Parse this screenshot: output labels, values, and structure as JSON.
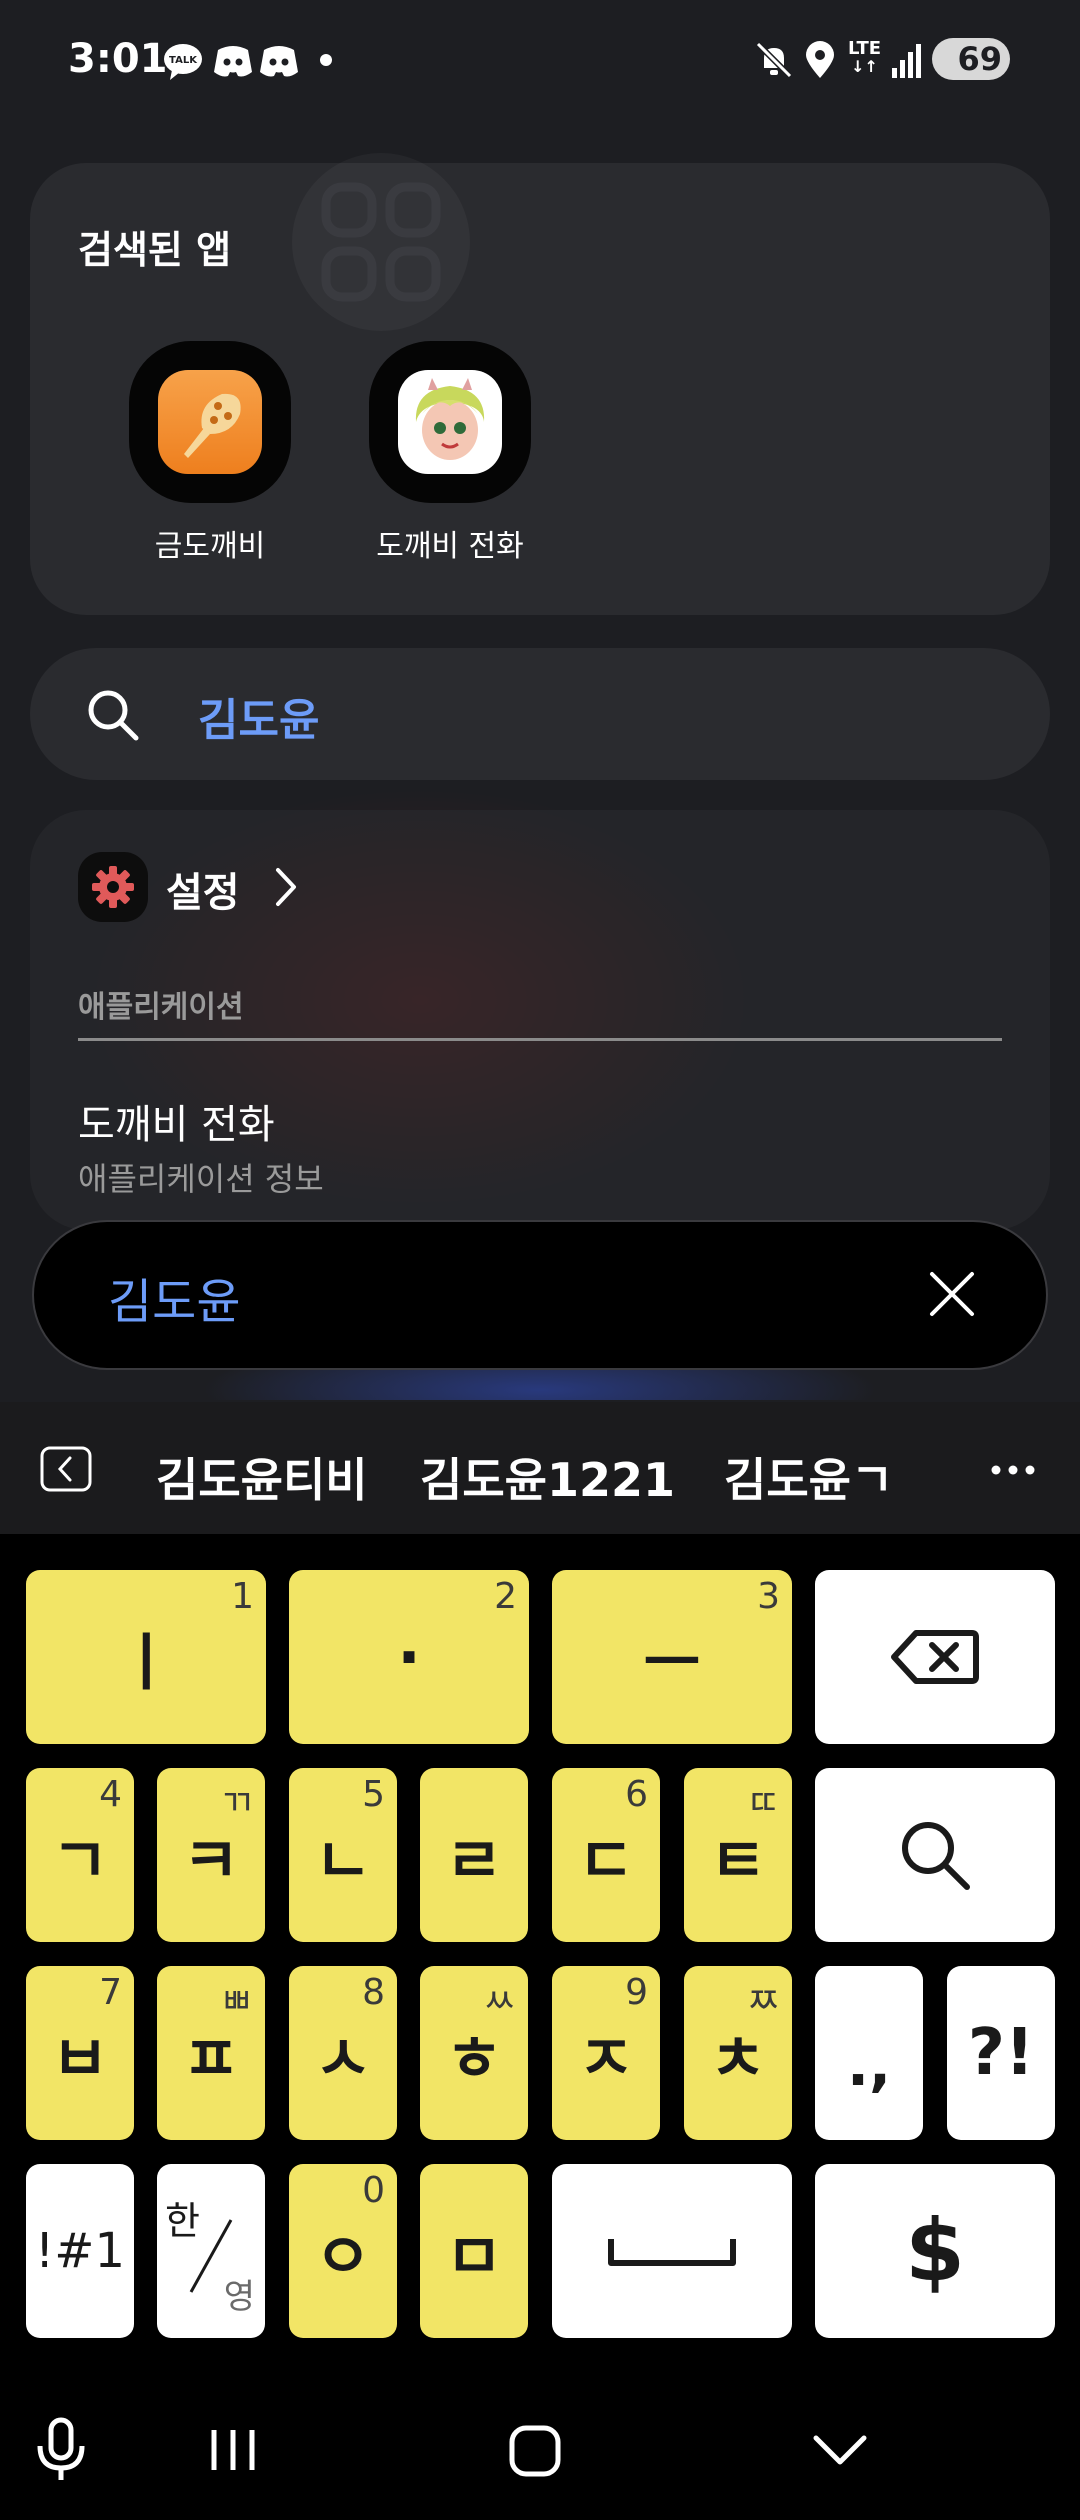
{
  "status_bar": {
    "time": "3:01",
    "icons": [
      "kakaotalk-icon",
      "discord-icon",
      "discord-icon",
      "dot-icon",
      "mute-icon",
      "location-icon",
      "lte-icon",
      "signal-icon"
    ],
    "network": "LTE",
    "battery": "69"
  },
  "apps_card": {
    "title": "검색된 앱",
    "apps": [
      {
        "label": "금도깨비",
        "icon": "golden-club-icon"
      },
      {
        "label": "도깨비 전화",
        "icon": "goblin-avatar-icon"
      }
    ]
  },
  "search": {
    "query": "김도윤"
  },
  "results": {
    "settings_title": "설정",
    "section_label": "애플리케이션",
    "item_title": "도깨비 전화",
    "item_subtitle": "애플리케이션 정보"
  },
  "floating_search": {
    "value": "김도윤"
  },
  "suggestions": {
    "items": [
      "김도윤티비",
      "김도윤1221",
      "김도윤ㄱ"
    ]
  },
  "keyboard": {
    "row1": [
      {
        "main": "ㅣ",
        "num": "1"
      },
      {
        "main": "·",
        "num": "2"
      },
      {
        "main": "ㅡ",
        "num": "3"
      }
    ],
    "row2": [
      {
        "main": "ㄱ",
        "num": "4"
      },
      {
        "main": "ㅋ",
        "num": "ㄲ"
      },
      {
        "main": "ㄴ",
        "num": "5"
      },
      {
        "main": "ㄹ",
        "num": ""
      },
      {
        "main": "ㄷ",
        "num": "6"
      },
      {
        "main": "ㅌ",
        "num": "ㄸ"
      }
    ],
    "row3": [
      {
        "main": "ㅂ",
        "num": "7"
      },
      {
        "main": "ㅍ",
        "num": "ㅃ"
      },
      {
        "main": "ㅅ",
        "num": "8"
      },
      {
        "main": "ㅎ",
        "num": "ㅆ"
      },
      {
        "main": "ㅈ",
        "num": "9"
      },
      {
        "main": "ㅊ",
        "num": "ㅉ"
      }
    ],
    "punct1": ".,",
    "punct2": "?!",
    "symbols": "!#1",
    "lang_top": "한",
    "lang_bottom": "영",
    "row4": [
      {
        "main": "ㅇ",
        "num": "0"
      },
      {
        "main": "ㅁ",
        "num": ""
      }
    ],
    "currency": "$"
  },
  "colors": {
    "accent": "#6d9cf8",
    "key_yellow": "#f2e566",
    "key_white": "#ffffff",
    "background": "#1d1e22"
  }
}
